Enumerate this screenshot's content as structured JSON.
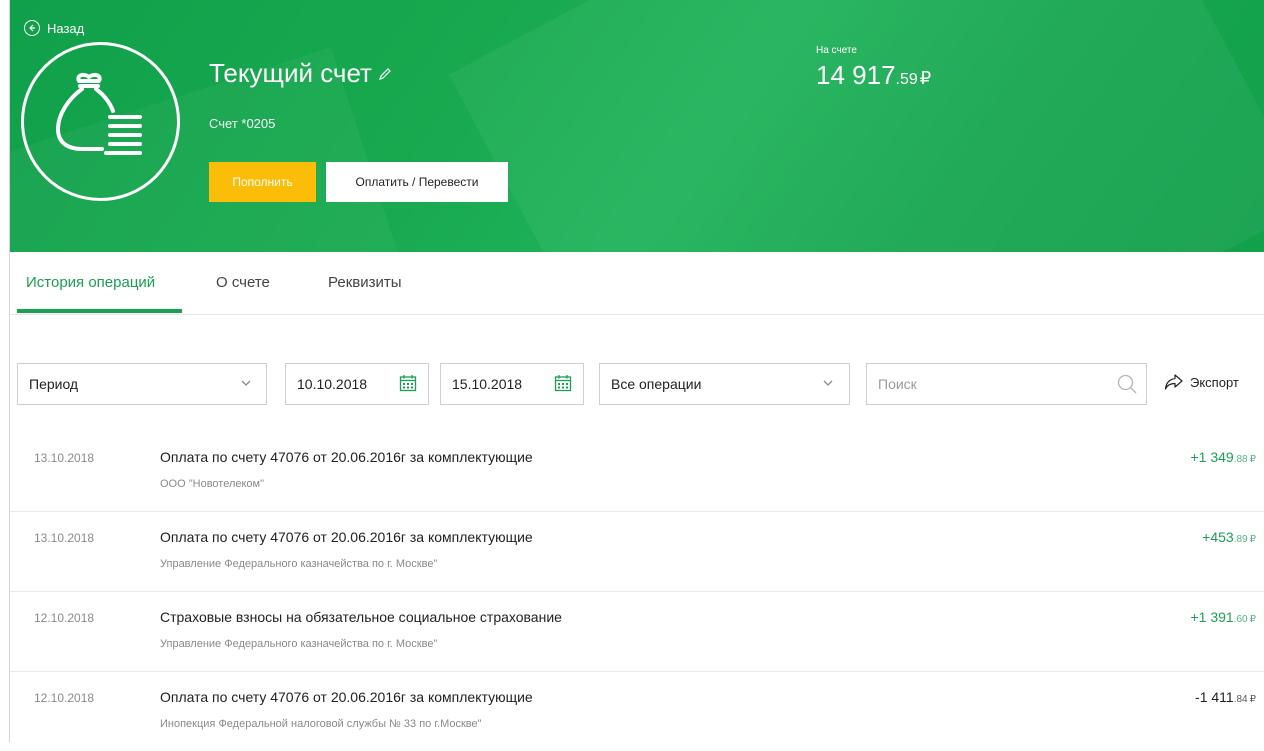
{
  "header": {
    "back_label": "Назад",
    "account_title": "Текущий счет",
    "account_number": "Счет *0205",
    "balance_label": "На счете",
    "balance_main": "14 917",
    "balance_kop": ".59",
    "currency": "₽",
    "topup_label": "Пополнить",
    "pay_label": "Оплатить / Перевести",
    "colors": {
      "green": "#1aa552",
      "accent_yellow": "#fbbd08"
    }
  },
  "tabs": [
    {
      "label": "История операций",
      "active": true
    },
    {
      "label": "О счете",
      "active": false
    },
    {
      "label": "Реквизиты",
      "active": false
    }
  ],
  "filters": {
    "period_value": "Период",
    "date_from": "10.10.2018",
    "date_to": "15.10.2018",
    "operations_value": "Все операции",
    "search_placeholder": "Поиск",
    "export_label": "Экспорт"
  },
  "operations": [
    {
      "date": "13.10.2018",
      "title": "Оплата по счету 47076 от 20.06.2016г за комплектующие",
      "counterparty": "ООО \"Новотелеком\"",
      "amount_main": "+1 349",
      "amount_kop": ".88",
      "currency": "₽",
      "direction": "in"
    },
    {
      "date": "13.10.2018",
      "title": "Оплата по счету 47076 от 20.06.2016г за комплектующие",
      "counterparty": "Управление Федерального казначейства по г. Москве\"",
      "amount_main": "+453",
      "amount_kop": ".89",
      "currency": "₽",
      "direction": "in"
    },
    {
      "date": "12.10.2018",
      "title": "Страховые взносы на обязательное социальное страхование",
      "counterparty": "Управление Федерального казначейства по г. Москве\"",
      "amount_main": "+1 391",
      "amount_kop": ".60",
      "currency": "₽",
      "direction": "in"
    },
    {
      "date": "12.10.2018",
      "title": "Оплата по счету 47076 от 20.06.2016г за комплектующие",
      "counterparty": "Инопекция Федеральной налоговой службы № 33 по г.Москве\"",
      "amount_main": "-1 411",
      "amount_kop": ".84",
      "currency": "₽",
      "direction": "out"
    }
  ]
}
